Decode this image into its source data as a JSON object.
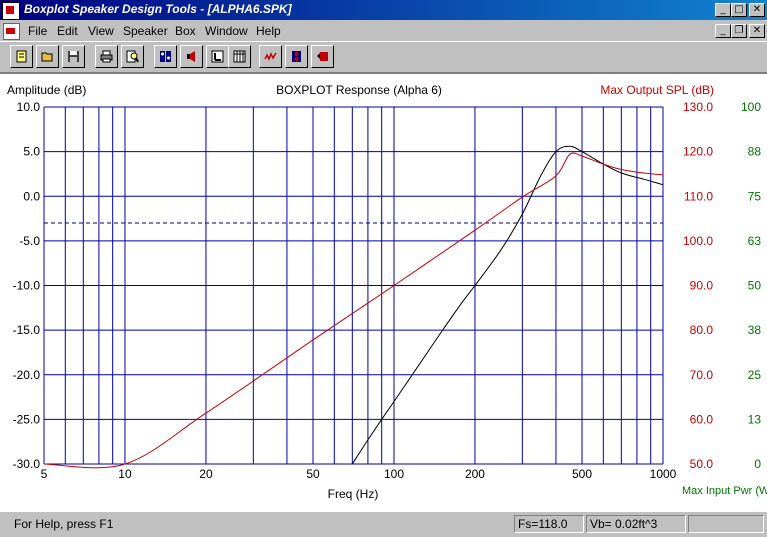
{
  "window": {
    "title": "Boxplot Speaker Design Tools - [ALPHA6.SPK]",
    "controls": {
      "minimize": "_",
      "maximize": "□",
      "close": "✕"
    },
    "doc_controls": {
      "minimize": "_",
      "restore": "❐",
      "close": "✕"
    }
  },
  "menu": {
    "items": [
      {
        "label": "File",
        "name": "menu-file"
      },
      {
        "label": "Edit",
        "name": "menu-edit"
      },
      {
        "label": "View",
        "name": "menu-view"
      },
      {
        "label": "Speaker",
        "name": "menu-speaker"
      },
      {
        "label": "Box",
        "name": "menu-box"
      },
      {
        "label": "Window",
        "name": "menu-window"
      },
      {
        "label": "Help",
        "name": "menu-help"
      }
    ]
  },
  "toolbar": {
    "buttons": [
      {
        "name": "new-file-button",
        "icon": "new-file-icon"
      },
      {
        "name": "open-file-button",
        "icon": "open-folder-icon"
      },
      {
        "name": "save-button",
        "icon": "floppy-disk-icon"
      },
      {
        "name": "print-button",
        "icon": "printer-icon"
      },
      {
        "name": "print-preview-button",
        "icon": "magnifier-page-icon"
      },
      {
        "name": "speaker-params-button",
        "icon": "speaker-params-icon"
      },
      {
        "name": "speaker-button",
        "icon": "loudspeaker-icon"
      },
      {
        "name": "box-button",
        "icon": "box-icon"
      },
      {
        "name": "table-button",
        "icon": "table-icon"
      },
      {
        "name": "response-graph-button",
        "icon": "response-graph-icon"
      },
      {
        "name": "enclosure-button",
        "icon": "enclosure-icon"
      },
      {
        "name": "spl-button",
        "icon": "spl-icon"
      }
    ]
  },
  "chart_data": {
    "type": "line",
    "title": "BOXPLOT Response (Alpha 6)",
    "xlabel": "Freq (Hz)",
    "ylabel_left": "Amplitude (dB)",
    "ylabel_right_1": "Max Output SPL (dB)",
    "ylabel_right_2": "Max Input Pwr (W",
    "x_scale": "log",
    "xlim": [
      5,
      1000
    ],
    "x_ticks": [
      5,
      10,
      20,
      50,
      100,
      200,
      500,
      1000
    ],
    "ylim": [
      -30,
      10
    ],
    "y_ticks": [
      "10.0",
      "5.0",
      "0.0",
      "-5.0",
      "-10.0",
      "-15.0",
      "-20.0",
      "-25.0",
      "-30.0"
    ],
    "right_ticks_spl": [
      "130.0",
      "120.0",
      "110.0",
      "100.0",
      "90.0",
      "80.0",
      "70.0",
      "60.0",
      "50.0"
    ],
    "right_ticks_pwr": [
      "100",
      "88",
      "75",
      "63",
      "50",
      "38",
      "25",
      "13",
      "0"
    ],
    "reference_line_db": -3,
    "grid": true,
    "colors": {
      "grid": "#0000aa",
      "amplitude": "#000000",
      "spl": "#cc0000",
      "pwr": "#007700",
      "reference": "#000080"
    },
    "series": [
      {
        "name": "Amplitude",
        "x": [
          70,
          80,
          90,
          100,
          120,
          150,
          180,
          200,
          250,
          300,
          350,
          400,
          450,
          500,
          600,
          700,
          850,
          1000
        ],
        "values": [
          -30,
          -27.3,
          -25,
          -23,
          -19.5,
          -15.2,
          -11.8,
          -10,
          -6,
          -2,
          2.2,
          5,
          5.6,
          5,
          3.6,
          2.6,
          1.9,
          1.3
        ]
      },
      {
        "name": "Max Output SPL",
        "x": [
          5,
          10,
          20,
          50,
          100,
          200,
          300,
          400,
          450,
          500,
          600,
          700,
          850,
          1000
        ],
        "values": [
          -30,
          -30,
          -24.3,
          -16.1,
          -10,
          -3.8,
          -0.1,
          2.3,
          4.7,
          4.5,
          3.6,
          3,
          2.6,
          2.4
        ]
      }
    ]
  },
  "status": {
    "help": "For Help, press F1",
    "fs": "Fs=118.0",
    "vb": "Vb= 0.02ft^3"
  }
}
